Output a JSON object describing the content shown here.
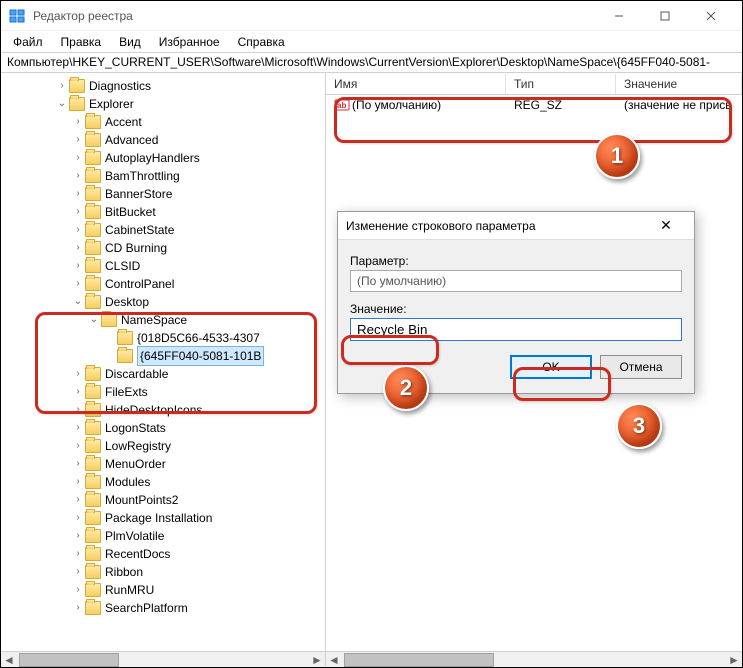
{
  "window": {
    "title": "Редактор реестра"
  },
  "menu": {
    "file": "Файл",
    "edit": "Правка",
    "view": "Вид",
    "favorites": "Избранное",
    "help": "Справка"
  },
  "path": "Компьютер\\HKEY_CURRENT_USER\\Software\\Microsoft\\Windows\\CurrentVersion\\Explorer\\Desktop\\NameSpace\\{645FF040-5081-",
  "tree": {
    "items_top": [
      "Diagnostics",
      "Explorer"
    ],
    "items_explorer": [
      "Accent",
      "Advanced",
      "AutoplayHandlers",
      "BamThrottling",
      "BannerStore",
      "BitBucket",
      "CabinetState",
      "CD Burning",
      "CLSID",
      "ControlPanel"
    ],
    "desktop": "Desktop",
    "namespace": "NameSpace",
    "ns_child1": "{018D5C66-4533-4307",
    "ns_child2": "{645FF040-5081-101B",
    "items_after": [
      "Discardable",
      "FileExts",
      "HideDesktopIcons",
      "LogonStats",
      "LowRegistry",
      "MenuOrder",
      "Modules",
      "MountPoints2",
      "Package Installation",
      "PlmVolatile",
      "RecentDocs",
      "Ribbon",
      "RunMRU",
      "SearchPlatform"
    ]
  },
  "listheader": {
    "name": "Имя",
    "type": "Тип",
    "value": "Значение"
  },
  "listrow": {
    "name": "(По умолчанию)",
    "type": "REG_SZ",
    "value": "(значение не присв"
  },
  "dialog": {
    "title": "Изменение строкового параметра",
    "param_label": "Параметр:",
    "param_value": "(По умолчанию)",
    "value_label": "Значение:",
    "value_input": "Recycle Bin",
    "ok": "OK",
    "cancel": "Отмена"
  },
  "badges": {
    "b1": "1",
    "b2": "2",
    "b3": "3"
  }
}
